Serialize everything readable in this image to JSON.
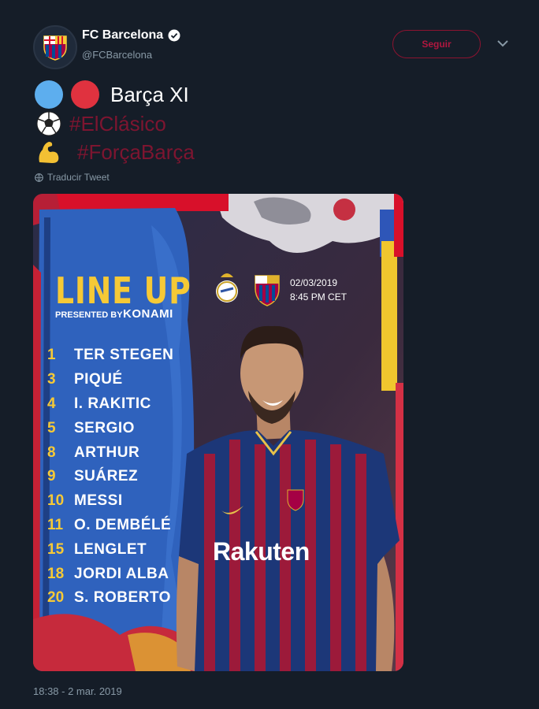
{
  "account": {
    "display_name": "FC Barcelona",
    "handle": "@FCBarcelona"
  },
  "follow_button": {
    "label": "Seguir"
  },
  "tweet": {
    "line1": "Barça XI",
    "hashtag1": "#ElClásico",
    "hashtag2": "#ForçaBarça",
    "translate_label": "Traducir Tweet",
    "timestamp": "18:38 - 2 mar. 2019"
  },
  "graphic": {
    "title": "LINE UP",
    "presented_by": "PRESENTED BY",
    "sponsor": "KONAMI",
    "match_date": "02/03/2019",
    "match_time": "8:45 PM CET",
    "shirt_sponsor": "Rakuten",
    "players": [
      {
        "number": "1",
        "name": "TER STEGEN"
      },
      {
        "number": "3",
        "name": "PIQUÉ"
      },
      {
        "number": "4",
        "name": "I. RAKITIC"
      },
      {
        "number": "5",
        "name": "SERGIO"
      },
      {
        "number": "8",
        "name": "ARTHUR"
      },
      {
        "number": "9",
        "name": "SUÁREZ"
      },
      {
        "number": "10",
        "name": "MESSI"
      },
      {
        "number": "11",
        "name": "O. DEMBÉLÉ"
      },
      {
        "number": "15",
        "name": "LENGLET"
      },
      {
        "number": "18",
        "name": "JORDI ALBA"
      },
      {
        "number": "20",
        "name": "S. ROBERTO"
      }
    ]
  },
  "icons": {
    "verified": "verified-badge-icon",
    "chevron": "chevron-down-icon",
    "globe": "globe-icon",
    "soccer": "soccer-ball-icon",
    "muscle": "flexed-biceps-icon"
  },
  "colors": {
    "background": "#151d28",
    "hashtag": "#7d1530",
    "follow_border": "#8c1330",
    "accent_yellow": "#f6c936"
  }
}
